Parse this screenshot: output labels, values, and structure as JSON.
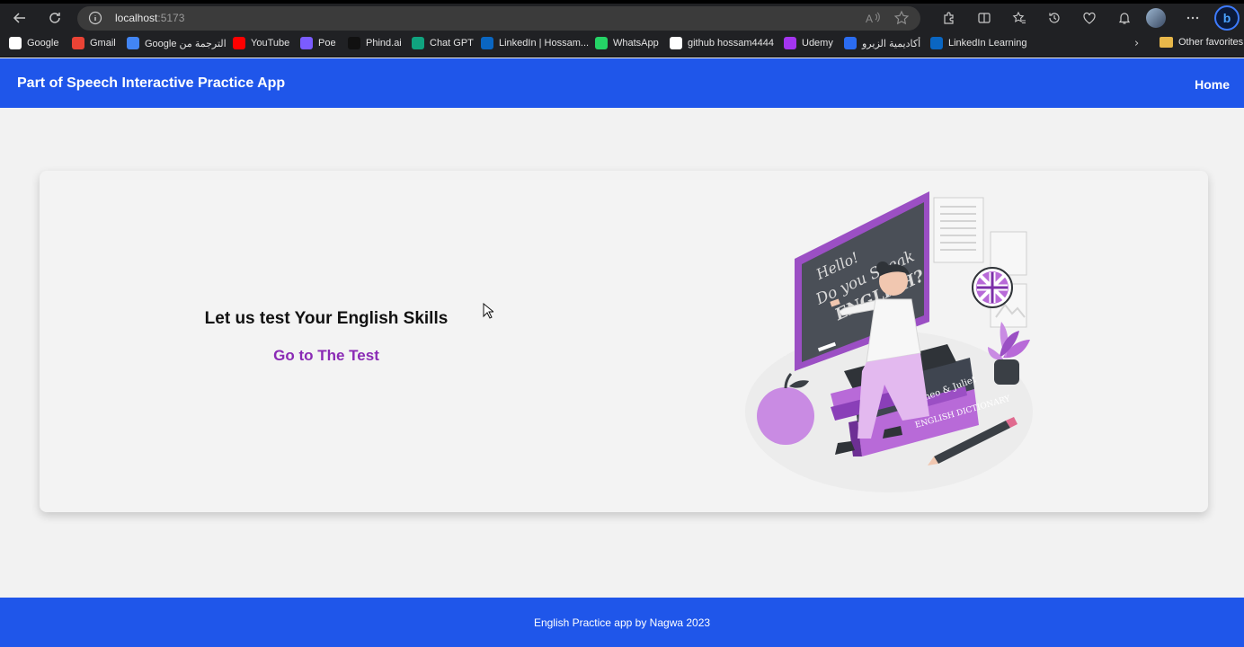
{
  "browser": {
    "url_host": "localhost",
    "url_port": ":5173",
    "bookmarks": [
      {
        "label": "Google",
        "icon": "google-icon",
        "color": "#ffffff"
      },
      {
        "label": "Gmail",
        "icon": "gmail-icon",
        "color": "#ea4335"
      },
      {
        "label": "Google الترجمة من",
        "icon": "google-translate-icon",
        "color": "#4285f4"
      },
      {
        "label": "YouTube",
        "icon": "youtube-icon",
        "color": "#ff0000"
      },
      {
        "label": "Poe",
        "icon": "poe-icon",
        "color": "#7b5cff"
      },
      {
        "label": "Phind.ai",
        "icon": "phind-icon",
        "color": "#111111"
      },
      {
        "label": "Chat GPT",
        "icon": "chatgpt-icon",
        "color": "#10a37f"
      },
      {
        "label": "LinkedIn | Hossam...",
        "icon": "linkedin-icon",
        "color": "#0a66c2"
      },
      {
        "label": "WhatsApp",
        "icon": "whatsapp-icon",
        "color": "#25d366"
      },
      {
        "label": "github hossam4444",
        "icon": "github-icon",
        "color": "#ffffff"
      },
      {
        "label": "Udemy",
        "icon": "udemy-icon",
        "color": "#a435f0"
      },
      {
        "label": "أكاديمية الزيرو",
        "icon": "zero-academy-icon",
        "color": "#2b6cf0"
      },
      {
        "label": "LinkedIn Learning",
        "icon": "linkedin-learning-icon",
        "color": "#0a66c2"
      }
    ],
    "other_favorites": "Other favorites"
  },
  "header": {
    "title": "Part of Speech Interactive Practice App",
    "home_label": "Home"
  },
  "main": {
    "heading": "Let us test Your English Skills",
    "cta_label": "Go to The Test"
  },
  "illustration": {
    "board_lines": [
      "Hello!",
      "Do you Speak",
      "ENGLISH?"
    ],
    "book_titles": [
      "Romeo & Juliet",
      "ENGLISH DICTIONARY"
    ]
  },
  "footer": {
    "text": "English Practice app by Nagwa 2023"
  },
  "colors": {
    "brand_blue": "#1f56ea",
    "link_purple": "#8a2ab5",
    "accent_purple": "#9b4fc4"
  }
}
